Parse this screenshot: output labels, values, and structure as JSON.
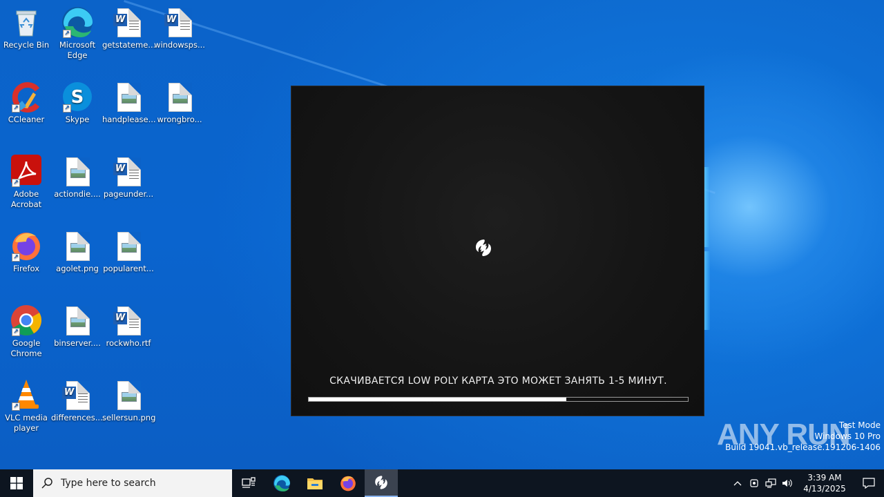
{
  "desktop": {
    "icons": [
      {
        "label": "Recycle Bin",
        "icon": "recycle-bin-icon"
      },
      {
        "label": "Microsoft Edge",
        "icon": "edge-icon"
      },
      {
        "label": "getstateme...",
        "icon": "word-doc-icon"
      },
      {
        "label": "windowsps...",
        "icon": "word-doc-icon"
      },
      {
        "label": "CCleaner",
        "icon": "ccleaner-icon"
      },
      {
        "label": "Skype",
        "icon": "skype-icon"
      },
      {
        "label": "handplease...",
        "icon": "image-file-icon"
      },
      {
        "label": "wrongbro...",
        "icon": "image-file-icon"
      },
      {
        "label": "Adobe Acrobat",
        "icon": "acrobat-icon"
      },
      {
        "label": "actiondie....",
        "icon": "image-file-icon"
      },
      {
        "label": "pageunder...",
        "icon": "word-doc-icon"
      },
      {
        "label": "Firefox",
        "icon": "firefox-icon"
      },
      {
        "label": "agolet.png",
        "icon": "image-file-icon"
      },
      {
        "label": "popularent...",
        "icon": "image-file-icon"
      },
      {
        "label": "Google Chrome",
        "icon": "chrome-icon"
      },
      {
        "label": "binserver....",
        "icon": "image-file-icon"
      },
      {
        "label": "rockwho.rtf",
        "icon": "word-doc-icon"
      },
      {
        "label": "VLC media player",
        "icon": "vlc-icon"
      },
      {
        "label": "differences....",
        "icon": "word-doc-icon"
      },
      {
        "label": "sellersun.png",
        "icon": "image-file-icon"
      }
    ]
  },
  "loader": {
    "message": "СКАЧИВАЕТСЯ LOW POLY КАРТА ЭТО МОЖЕТ ЗАНЯТЬ 1-5 МИНУТ.",
    "progress": 0.68,
    "logo_icon": "app-logo-icon"
  },
  "watermark": {
    "brand": "ANY RUN",
    "line1": "Test Mode",
    "line2": "Windows 10 Pro",
    "line3": "Build 19041.vb_release.191206-1406"
  },
  "taskbar": {
    "search_placeholder": "Type here to search",
    "apps": [
      "task-view-icon",
      "edge-icon",
      "file-explorer-icon",
      "firefox-icon",
      "app-logo-icon"
    ],
    "time": "3:39 AM",
    "date": "4/13/2025"
  }
}
